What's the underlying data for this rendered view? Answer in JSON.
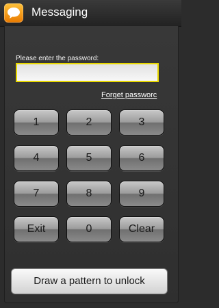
{
  "header": {
    "title": "Messaging",
    "icon": "chat-bubble-icon",
    "icon_color": "#f39c12"
  },
  "password": {
    "label": "Please enter the password:",
    "value": "",
    "focus_border_color": "#e8d800"
  },
  "forget_link": "Forget passworc",
  "keypad": {
    "keys": [
      "1",
      "2",
      "3",
      "4",
      "5",
      "6",
      "7",
      "8",
      "9",
      "Exit",
      "0",
      "Clear"
    ]
  },
  "unlock_button": "Draw a pattern to unlock"
}
